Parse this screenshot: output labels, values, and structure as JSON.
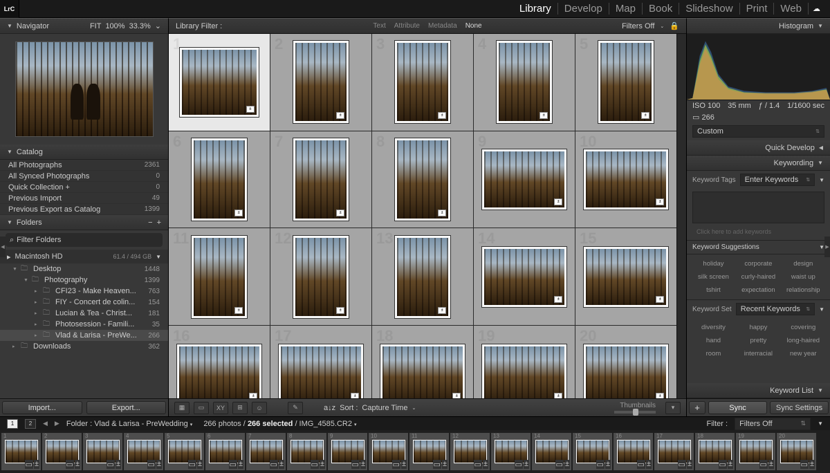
{
  "app": {
    "logo": "LrC"
  },
  "modules": [
    "Library",
    "Develop",
    "Map",
    "Book",
    "Slideshow",
    "Print",
    "Web"
  ],
  "active_module": "Library",
  "navigator": {
    "title": "Navigator",
    "fit": "FIT",
    "pct100": "100%",
    "pct33": "33.3%"
  },
  "catalog": {
    "title": "Catalog",
    "rows": [
      {
        "label": "All Photographs",
        "count": "2361"
      },
      {
        "label": "All Synced Photographs",
        "count": "0"
      },
      {
        "label": "Quick Collection  +",
        "count": "0"
      },
      {
        "label": "Previous Import",
        "count": "49"
      },
      {
        "label": "Previous Export as Catalog",
        "count": "1399"
      }
    ]
  },
  "folders": {
    "title": "Folders",
    "search_placeholder": "Filter Folders",
    "drive": {
      "name": "Macintosh HD",
      "info": "61.4 / 494 GB"
    },
    "tree": [
      {
        "depth": 1,
        "label": "Desktop",
        "count": "1448",
        "expanded": true
      },
      {
        "depth": 2,
        "label": "Photography",
        "count": "1399",
        "expanded": true
      },
      {
        "depth": 3,
        "label": "CFI23 - Make Heaven...",
        "count": "763"
      },
      {
        "depth": 3,
        "label": "FIY - Concert de colin...",
        "count": "154"
      },
      {
        "depth": 3,
        "label": "Lucian & Tea - Christ...",
        "count": "181"
      },
      {
        "depth": 3,
        "label": "Photosession - Famili...",
        "count": "35"
      },
      {
        "depth": 3,
        "label": "Vlad & Larisa - PreWe...",
        "count": "266",
        "selected": true
      },
      {
        "depth": 1,
        "label": "Downloads",
        "count": "362"
      }
    ]
  },
  "left_buttons": {
    "import": "Import...",
    "export": "Export..."
  },
  "filterbar": {
    "title": "Library Filter :",
    "tabs": [
      "Text",
      "Attribute",
      "Metadata",
      "None"
    ],
    "active": "None",
    "filters_label": "Filters Off"
  },
  "grid": {
    "cells": [
      {
        "n": 1,
        "selected": true,
        "shape": "land"
      },
      {
        "n": 2,
        "shape": "portrait"
      },
      {
        "n": 3,
        "shape": "portrait"
      },
      {
        "n": 4,
        "shape": "portrait"
      },
      {
        "n": 5,
        "shape": "portrait"
      },
      {
        "n": 6,
        "shape": "portrait"
      },
      {
        "n": 7,
        "shape": "portrait"
      },
      {
        "n": 8,
        "shape": "portrait"
      },
      {
        "n": 9,
        "shape": "wide"
      },
      {
        "n": 10,
        "shape": "wide"
      },
      {
        "n": 11,
        "shape": "portrait"
      },
      {
        "n": 12,
        "shape": "portrait"
      },
      {
        "n": 13,
        "shape": "portrait"
      },
      {
        "n": 14,
        "shape": "wide"
      },
      {
        "n": 15,
        "shape": "wide"
      },
      {
        "n": 16,
        "shape": "wide"
      },
      {
        "n": 17,
        "shape": "wide"
      },
      {
        "n": 18,
        "shape": "wide"
      },
      {
        "n": 19,
        "shape": "wide"
      },
      {
        "n": 20,
        "shape": "wide"
      }
    ]
  },
  "toolbar": {
    "sort_label": "Sort :",
    "sort_value": "Capture Time",
    "thumbnails": "Thumbnails"
  },
  "right": {
    "histogram": {
      "title": "Histogram",
      "iso": "ISO 100",
      "focal": "35 mm",
      "aperture": "ƒ / 1.4",
      "shutter": "1/1600 sec",
      "selcount": "266"
    },
    "quickdev": {
      "title": "Quick Develop",
      "preset": "Custom"
    },
    "keywording": {
      "title": "Keywording",
      "tags_label": "Keyword Tags",
      "tags_input": "Enter Keywords",
      "hint": "Click here to add keywords",
      "sugg_title": "Keyword Suggestions",
      "sugg": [
        "holiday",
        "corporate",
        "design",
        "silk screen",
        "curly-haired",
        "waist up",
        "tshirt",
        "expectation",
        "relationship"
      ],
      "set_label": "Keyword Set",
      "set_value": "Recent Keywords",
      "set_items": [
        "diversity",
        "happy",
        "covering",
        "hand",
        "pretty",
        "long-haired",
        "room",
        "interracial",
        "new year"
      ]
    },
    "keyword_list": {
      "title": "Keyword List"
    },
    "sync": {
      "sync": "Sync",
      "settings": "Sync Settings"
    }
  },
  "status": {
    "screen1": "1",
    "screen2": "2",
    "folder": "Folder : Vlad & Larisa - PreWedding",
    "count": "266 photos /",
    "selected": "266 selected",
    "file": "/ IMG_4585.CR2",
    "filter_label": "Filter :",
    "filter_value": "Filters Off"
  },
  "filmstrip": {
    "count": 20
  }
}
